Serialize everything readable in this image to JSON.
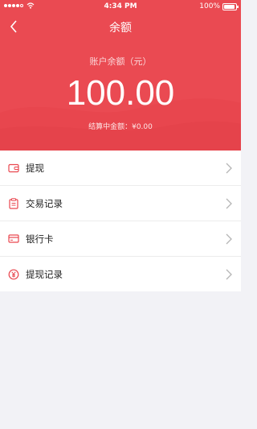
{
  "status_bar": {
    "time": "4:34 PM",
    "battery": "100%"
  },
  "nav": {
    "title": "余额"
  },
  "balance": {
    "label": "账户余额（元）",
    "amount": "100.00",
    "settling": "结算中金额：¥0.00"
  },
  "menu": [
    {
      "label": "提现",
      "icon": "wallet-icon"
    },
    {
      "label": "交易记录",
      "icon": "clipboard-icon"
    },
    {
      "label": "银行卡",
      "icon": "card-icon"
    },
    {
      "label": "提现记录",
      "icon": "yen-coin-icon"
    }
  ],
  "colors": {
    "accent": "#ea4a52",
    "icon": "#e9474f",
    "background": "#f2f2f6"
  }
}
